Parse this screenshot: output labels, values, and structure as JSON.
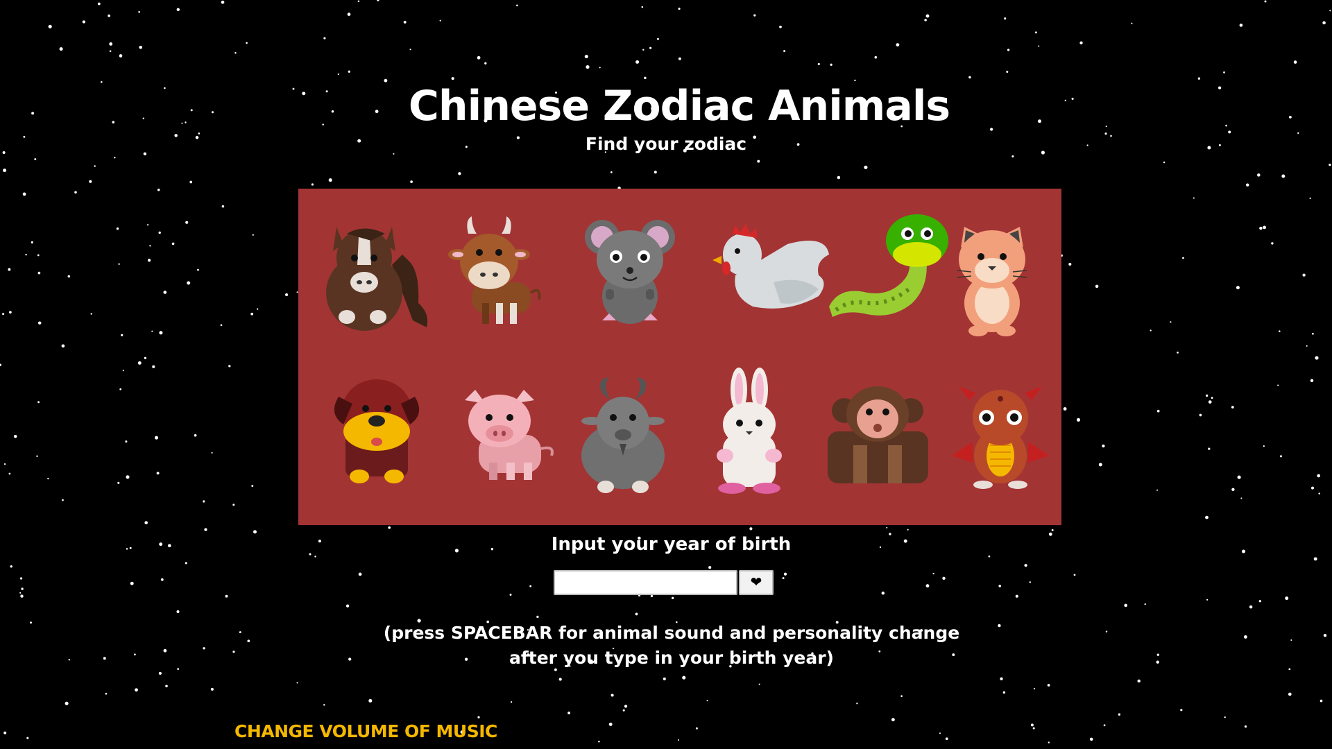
{
  "header": {
    "title": "Chinese Zodiac Animals",
    "subtitle": "Find your zodiac"
  },
  "panel": {
    "background": "#a33434",
    "animals_row1": [
      "horse",
      "ox",
      "rat",
      "rooster",
      "snake",
      "tiger"
    ],
    "animals_row2": [
      "dog",
      "pig",
      "goat",
      "rabbit",
      "monkey",
      "dragon"
    ]
  },
  "form": {
    "prompt": "Input your year of birth",
    "input_value": "",
    "submit_icon": "heart-icon",
    "submit_glyph": "❤"
  },
  "hint": {
    "line1": "(press SPACEBAR for animal sound and personality change",
    "line2": "after you type in your birth year)"
  },
  "footer": {
    "volume_label": "CHANGE VOLUME OF MUSIC",
    "volume_color": "#f5b800"
  }
}
